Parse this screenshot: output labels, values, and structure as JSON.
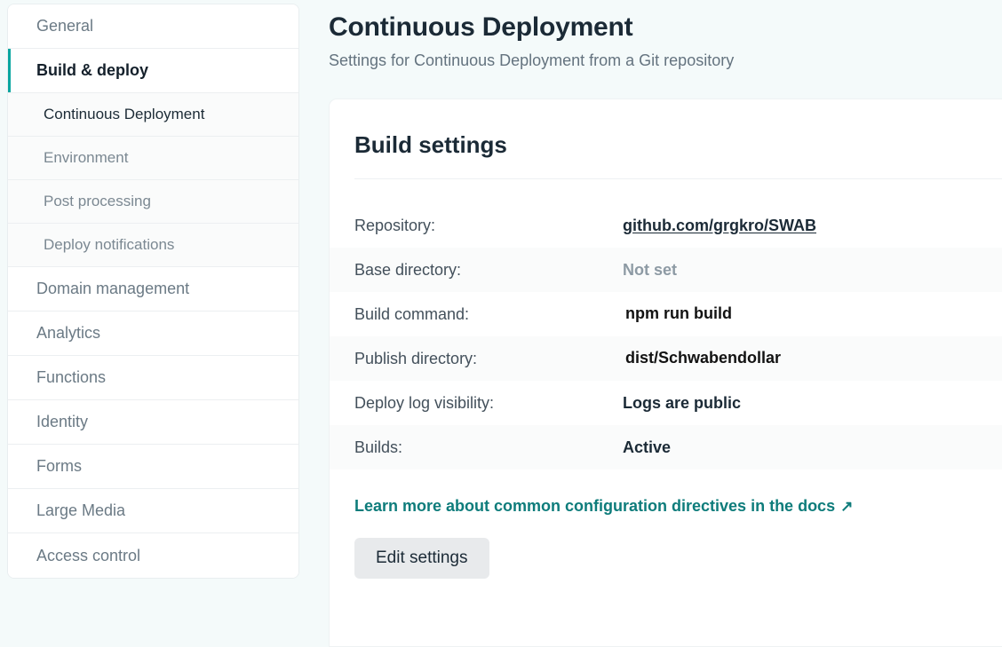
{
  "sidebar": {
    "items": [
      {
        "label": "General",
        "type": "top",
        "active": false
      },
      {
        "label": "Build & deploy",
        "type": "top",
        "active": true
      },
      {
        "label": "Continuous Deployment",
        "type": "sub",
        "active": true
      },
      {
        "label": "Environment",
        "type": "sub",
        "active": false
      },
      {
        "label": "Post processing",
        "type": "sub",
        "active": false
      },
      {
        "label": "Deploy notifications",
        "type": "sub",
        "active": false
      },
      {
        "label": "Domain management",
        "type": "top",
        "active": false
      },
      {
        "label": "Analytics",
        "type": "top",
        "active": false
      },
      {
        "label": "Functions",
        "type": "top",
        "active": false
      },
      {
        "label": "Identity",
        "type": "top",
        "active": false
      },
      {
        "label": "Forms",
        "type": "top",
        "active": false
      },
      {
        "label": "Large Media",
        "type": "top",
        "active": false
      },
      {
        "label": "Access control",
        "type": "top",
        "active": false
      }
    ]
  },
  "header": {
    "title": "Continuous Deployment",
    "subtitle": "Settings for Continuous Deployment from a Git repository"
  },
  "card": {
    "title": "Build settings",
    "rows": [
      {
        "label": "Repository:",
        "value": "github.com/grgkro/SWAB",
        "style": "link",
        "highlight": false
      },
      {
        "label": "Base directory:",
        "value": "Not set",
        "style": "muted",
        "highlight": false
      },
      {
        "label": "Build command:",
        "value": "npm run build",
        "style": "plain",
        "highlight": true
      },
      {
        "label": "Publish directory:",
        "value": "dist/Schwabendollar",
        "style": "plain",
        "highlight": true
      },
      {
        "label": "Deploy log visibility:",
        "value": "Logs are public",
        "style": "plain",
        "highlight": false
      },
      {
        "label": "Builds:",
        "value": "Active",
        "style": "plain",
        "highlight": false
      }
    ],
    "docs_link": "Learn more about common configuration directives in the docs",
    "docs_link_arrow": "↗",
    "edit_button": "Edit settings"
  },
  "colors": {
    "accent_teal": "#0e7c7b",
    "active_bar": "#08a6a0",
    "highlight_yellow": "#ffef00",
    "page_background": "#f4fafa",
    "text_dark": "#1b2a36",
    "text_muted": "#8d9aa4"
  }
}
